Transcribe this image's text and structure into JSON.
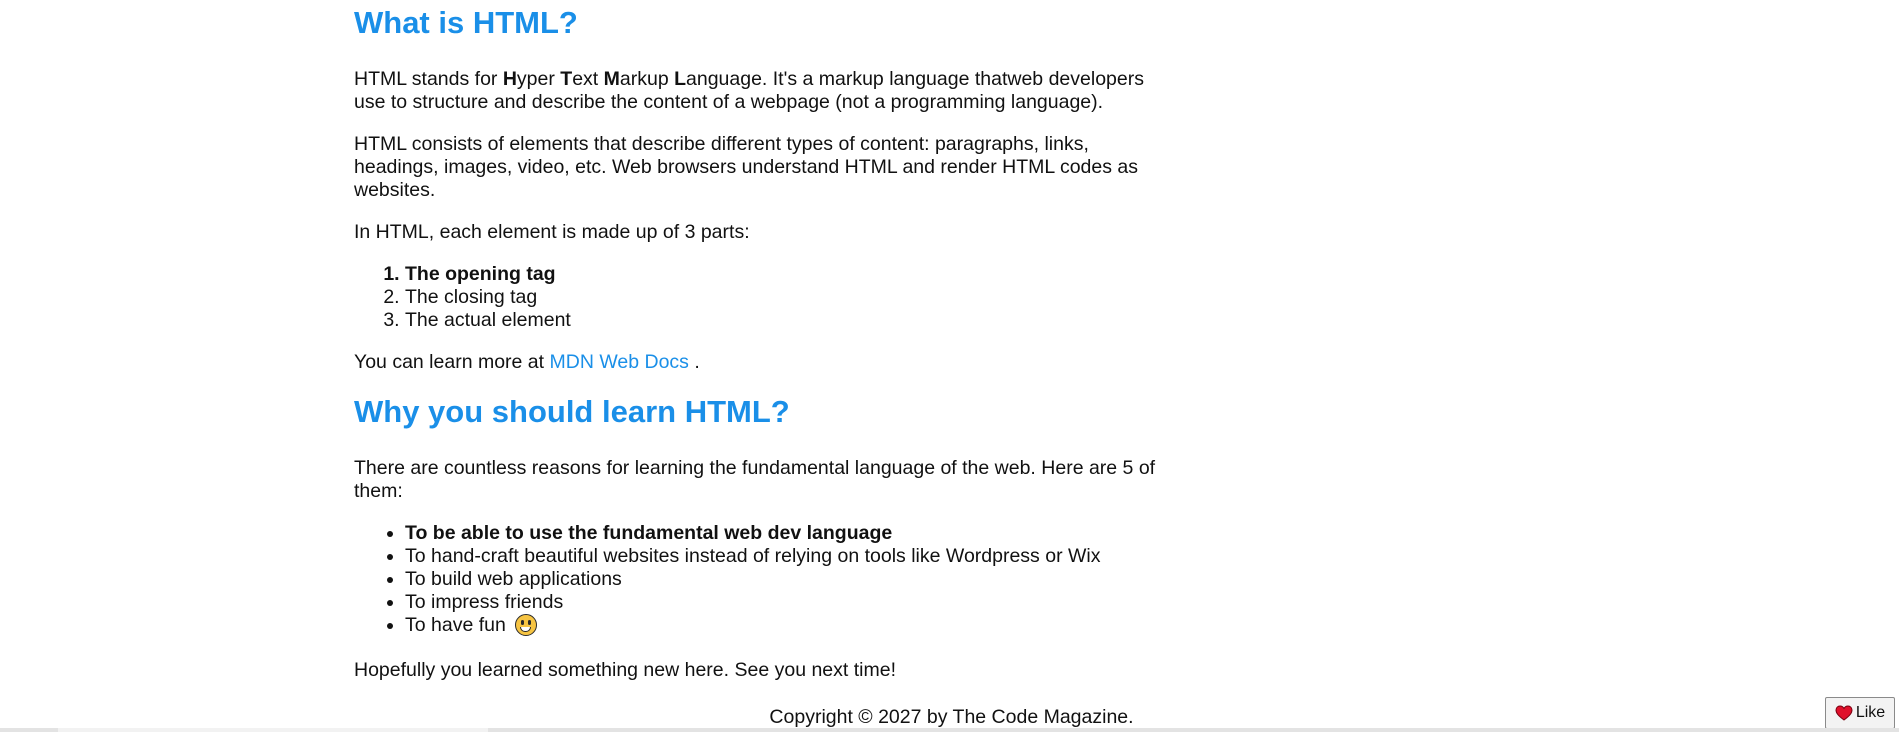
{
  "article": {
    "section1": {
      "heading": "What is HTML?",
      "p1": {
        "prefix": "HTML stands for ",
        "h_bold": "H",
        "h_rest": "yper ",
        "t_bold": "T",
        "t_rest": "ext ",
        "m_bold": "M",
        "m_rest": "arkup ",
        "l_bold": "L",
        "suffix": "anguage. It's a markup language thatweb developers use to structure and describe the content of a webpage (not a programming language)."
      },
      "p2": "HTML consists of elements that describe different types of content: paragraphs, links, headings, images, video, etc. Web browsers understand HTML and render HTML codes as websites.",
      "p3": "In HTML, each element is made up of 3 parts:",
      "parts": [
        "The opening tag",
        "The closing tag",
        "The actual element"
      ],
      "learn_more": {
        "prefix": "You can learn more at ",
        "link_text": "MDN Web Docs",
        "suffix": " ."
      }
    },
    "section2": {
      "heading": "Why you should learn HTML?",
      "p1": "There are countless reasons for learning the fundamental language of the web. Here are 5 of them:",
      "reasons": [
        "To be able to use the fundamental web dev language",
        "To hand-craft beautiful websites instead of relying on tools like Wordpress or Wix",
        "To build web applications",
        "To impress friends",
        "To have fun"
      ],
      "reason5_emoji": "grinning-face-emoji",
      "closing": "Hopefully you learned something new here. See you next time!"
    }
  },
  "footer": {
    "copyright": "Copyright © 2027 by The Code Magazine."
  },
  "like_button": {
    "label": "Like",
    "icon": "heart-icon",
    "icon_color": "#e0102b"
  },
  "colors": {
    "heading": "#1a8fe8",
    "link": "#1a8fe8",
    "text": "#111111"
  }
}
